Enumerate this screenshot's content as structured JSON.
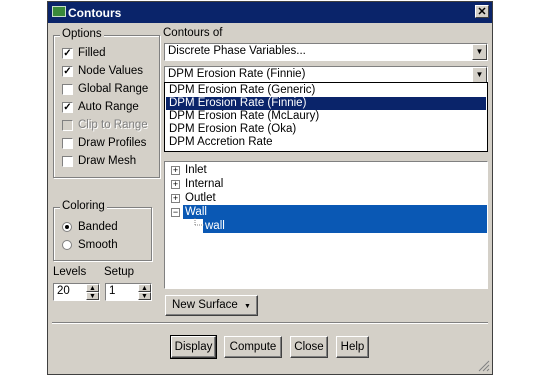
{
  "window": {
    "title": "Contours",
    "close_glyph": "✕"
  },
  "options": {
    "legend": "Options",
    "items": [
      {
        "label": "Filled",
        "checked": true,
        "disabled": false
      },
      {
        "label": "Node Values",
        "checked": true,
        "disabled": false
      },
      {
        "label": "Global Range",
        "checked": false,
        "disabled": false
      },
      {
        "label": "Auto Range",
        "checked": true,
        "disabled": false
      },
      {
        "label": "Clip to Range",
        "checked": false,
        "disabled": true
      },
      {
        "label": "Draw Profiles",
        "checked": false,
        "disabled": false
      },
      {
        "label": "Draw Mesh",
        "checked": false,
        "disabled": false
      }
    ]
  },
  "coloring": {
    "legend": "Coloring",
    "options": [
      {
        "label": "Banded",
        "selected": true
      },
      {
        "label": "Smooth",
        "selected": false
      }
    ]
  },
  "levels": {
    "label": "Levels",
    "value": "20"
  },
  "setup": {
    "label": "Setup",
    "value": "1"
  },
  "contours_of": {
    "label": "Contours of",
    "category": "Discrete Phase Variables...",
    "selected": "DPM Erosion Rate (Finnie)",
    "list": [
      {
        "label": "DPM Erosion Rate (Generic)",
        "selected": false
      },
      {
        "label": "DPM Erosion Rate (Finnie)",
        "selected": true
      },
      {
        "label": "DPM Erosion Rate (McLaury)",
        "selected": false
      },
      {
        "label": "DPM Erosion Rate (Oka)",
        "selected": false
      },
      {
        "label": "DPM Accretion Rate",
        "selected": false
      }
    ]
  },
  "surfaces": {
    "tree": [
      {
        "label": "Inlet",
        "expander": "+",
        "selected": false
      },
      {
        "label": "Internal",
        "expander": "+",
        "selected": false
      },
      {
        "label": "Outlet",
        "expander": "+",
        "selected": false
      },
      {
        "label": "Wall",
        "expander": "−",
        "selected": true
      },
      {
        "label": "wall",
        "child": true,
        "selected": true
      }
    ],
    "new_surface_label": "New Surface"
  },
  "buttons": {
    "display": "Display",
    "compute": "Compute",
    "close": "Close",
    "help": "Help"
  },
  "colors": {
    "face": "#d4d0c8",
    "title_bar": "#0a246a",
    "selection": "#0a58b4"
  },
  "icons": {
    "check": "✓",
    "down": "▼",
    "up_small": "▲",
    "down_small": "▼"
  }
}
